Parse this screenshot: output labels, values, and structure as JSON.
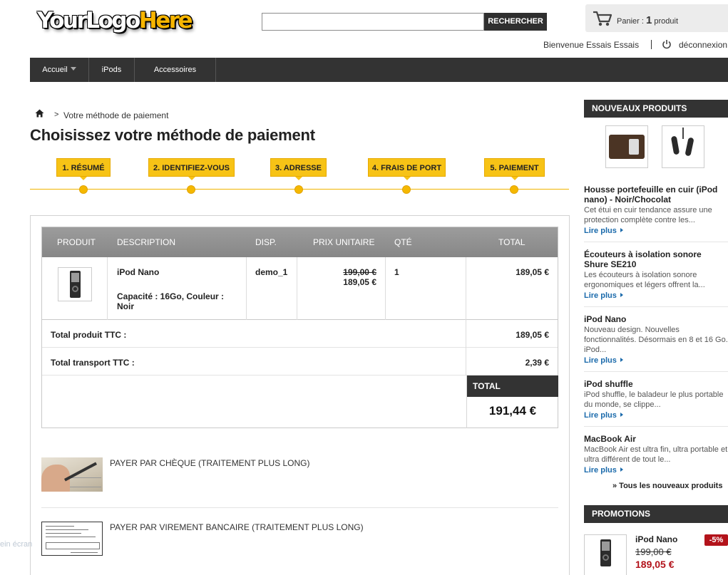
{
  "header": {
    "logo_part1": "YourLogo",
    "logo_part2": "Here",
    "search_value": "",
    "search_button": "RECHERCHER",
    "cart_label": "Panier :",
    "cart_count": "1",
    "cart_unit": "produit",
    "welcome": "Bienvenue Essais Essais",
    "logout": "déconnexion"
  },
  "nav": {
    "items": [
      {
        "label": "Accueil"
      },
      {
        "label": "iPods"
      },
      {
        "label": "Accessoires"
      }
    ]
  },
  "breadcrumb": {
    "separator": ">",
    "current": "Votre méthode de paiement"
  },
  "page_title": "Choisissez votre méthode de paiement",
  "steps": [
    {
      "label": "1. RÉSUMÉ"
    },
    {
      "label": "2. IDENTIFIEZ-VOUS"
    },
    {
      "label": "3. ADRESSE"
    },
    {
      "label": "4. FRAIS DE PORT"
    },
    {
      "label": "5. PAIEMENT"
    }
  ],
  "cart_table": {
    "headers": [
      "PRODUIT",
      "DESCRIPTION",
      "DISP.",
      "PRIX UNITAIRE",
      "QTÉ",
      "TOTAL"
    ],
    "rows": [
      {
        "name": "iPod Nano",
        "attributes": "Capacité : 16Go, Couleur : Noir",
        "availability": "demo_1",
        "old_price": "199,00 €",
        "price": "189,05 €",
        "qty": "1",
        "total": "189,05 €"
      }
    ],
    "total_products_label": "Total produit TTC :",
    "total_products": "189,05 €",
    "total_shipping_label": "Total transport TTC :",
    "total_shipping": "2,39 €",
    "total_label": "TOTAL",
    "total": "191,44 €"
  },
  "payments": [
    {
      "label": "PAYER PAR CHÈQUE (TRAITEMENT PLUS LONG)"
    },
    {
      "label": "PAYER PAR VIREMENT BANCAIRE (TRAITEMENT PLUS LONG)"
    }
  ],
  "left_edge_text": "ein écran",
  "sidebar": {
    "new_products_title": "NOUVEAUX PRODUITS",
    "new_products": [
      {
        "title": "Housse portefeuille en cuir (iPod nano) - Noir/Chocolat",
        "desc": "Cet étui en cuir tendance assure une protection complète contre les...",
        "more": "Lire plus"
      },
      {
        "title": "Écouteurs à isolation sonore Shure SE210",
        "desc": "Les écouteurs à isolation sonore ergonomiques et légers offrent la...",
        "more": "Lire plus"
      },
      {
        "title": "iPod Nano",
        "desc": "Nouveau design. Nouvelles fonctionnalités. Désormais en 8 et 16 Go. iPod...",
        "more": "Lire plus"
      },
      {
        "title": "iPod shuffle",
        "desc": "iPod shuffle, le baladeur le plus portable du monde, se clippe...",
        "more": "Lire plus"
      },
      {
        "title": "MacBook Air",
        "desc": "MacBook Air est ultra fin, ultra portable et ultra différent de tout le...",
        "more": "Lire plus"
      }
    ],
    "all_new_products": "» Tous les nouveaux produits",
    "promotions_title": "PROMOTIONS",
    "promo": {
      "name": "iPod Nano",
      "old_price": "199,00 €",
      "price": "189,05 €",
      "badge": "-5%"
    }
  },
  "colors": {
    "accent_yellow": "#f7c316",
    "dark_bar": "#333333",
    "link_blue": "#1a6aab",
    "promo_red": "#b3131b"
  }
}
